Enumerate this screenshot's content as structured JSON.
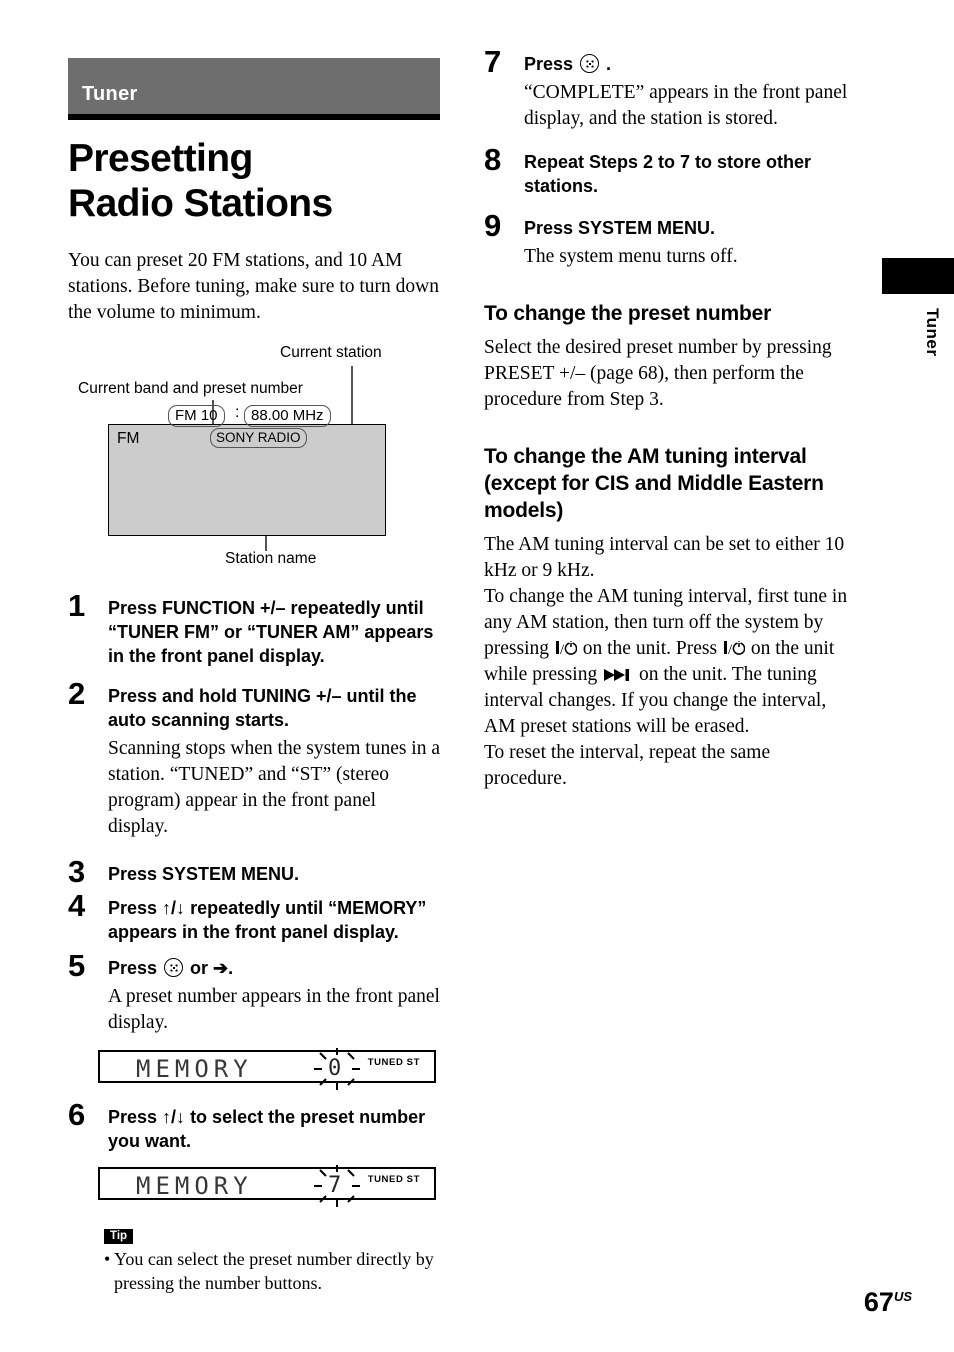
{
  "chapter": {
    "label": "Tuner"
  },
  "title": "Presetting Radio Stations",
  "intro": "You can preset 20 FM stations, and 10 AM stations. Before tuning, make sure to turn down the volume to minimum.",
  "diagram": {
    "caption_station": "Current station",
    "caption_band": "Current band and preset number",
    "caption_name": "Station name",
    "screen_band": "FM",
    "pill_band": "FM 10",
    "pill_separator": ":",
    "pill_freq": "88.00 MHz",
    "pill_name": "SONY RADIO",
    "screen_color": "#cccccc"
  },
  "steps": [
    {
      "num": "1",
      "head": "Press FUNCTION +/– repeatedly until “TUNER FM” or “TUNER AM” appears in the front panel display.",
      "desc": ""
    },
    {
      "num": "2",
      "head": "Press and hold TUNING +/– until the auto scanning starts.",
      "desc": "Scanning stops when the system tunes in a station. “TUNED” and “ST” (stereo program) appear in the front panel display."
    },
    {
      "num": "3",
      "head": "Press SYSTEM MENU.",
      "desc": ""
    },
    {
      "num": "4",
      "head_pre": "Press ",
      "head_syms": "↑/↓",
      "head_post": " repeatedly until “MEMORY” appears in the front panel display.",
      "desc": ""
    },
    {
      "num": "5",
      "head_pre": "Press ",
      "head_post": " or ➔.",
      "desc": "A preset number appears in the front panel display."
    },
    {
      "num": "6",
      "head_pre": "Press ",
      "head_syms": "↑/↓",
      "head_post": " to select the preset number you want.",
      "desc": ""
    },
    {
      "num": "7",
      "head_pre": "Press ",
      "head_post": " .",
      "desc": "“COMPLETE” appears in the front panel display, and the station is stored."
    },
    {
      "num": "8",
      "head": "Repeat Steps 2 to 7 to store other stations.",
      "desc": ""
    },
    {
      "num": "9",
      "head": "Press SYSTEM MENU.",
      "desc": "The system menu turns off."
    }
  ],
  "lcd1": {
    "text": "MEMORY",
    "number": "0",
    "indicators": "TUNED ST"
  },
  "lcd2": {
    "text": "MEMORY",
    "number": "7",
    "indicators": "TUNED ST"
  },
  "tip": {
    "badge": "Tip",
    "text": "• You can select the preset number directly by pressing the number buttons."
  },
  "sections": [
    {
      "heading": "To change the preset number",
      "body": "Select the desired preset number by pressing PRESET +/– (page 68), then perform the procedure from Step 3."
    },
    {
      "heading": "To change the AM tuning interval (except for CIS and Middle Eastern models)",
      "body_1": "The AM tuning interval can be set to either 10 kHz or 9 kHz.",
      "body_2a": "To change the AM tuning interval, first tune in any AM station, then turn off the system by pressing ",
      "body_2b": " on the unit. Press ",
      "body_2c": " on the unit while pressing ",
      "body_2d": " on the unit. The tuning interval changes. If you change the interval, AM preset stations will be erased.",
      "body_3": "To reset the interval, repeat the same procedure."
    }
  ],
  "side_tab_label": "Tuner",
  "folio": {
    "number": "67",
    "region": "US"
  }
}
